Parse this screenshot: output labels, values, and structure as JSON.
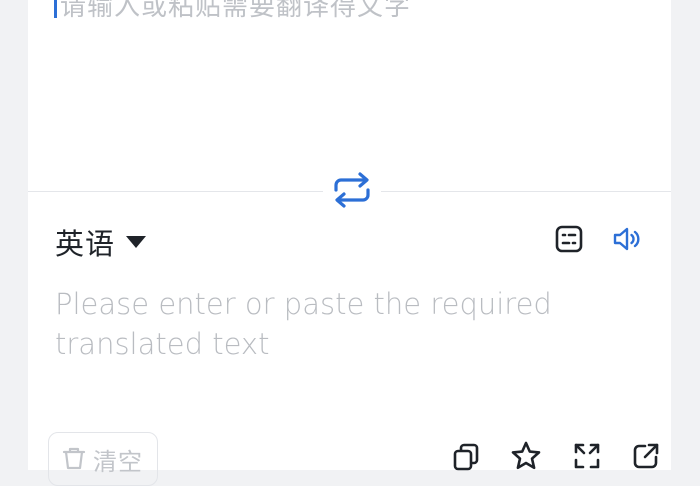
{
  "source": {
    "placeholder": "请输入或粘贴需要翻译得文字"
  },
  "target_language": {
    "label": "英语"
  },
  "target": {
    "placeholder": "Please enter or paste the required translated text"
  },
  "buttons": {
    "clear_label": "清空"
  },
  "icons": {
    "swap": "swap-arrows-icon",
    "caret": "caret-down-icon",
    "keyboard": "keyboard-icon",
    "speaker": "speaker-icon",
    "copy": "copy-icon",
    "favorite": "star-icon",
    "fullscreen": "expand-icon",
    "share": "share-icon",
    "clear": "trash-icon"
  },
  "colors": {
    "accent": "#2c6fd6",
    "placeholder": "#b9bcc1",
    "text": "#1f2329",
    "background": "#f1f2f4"
  }
}
